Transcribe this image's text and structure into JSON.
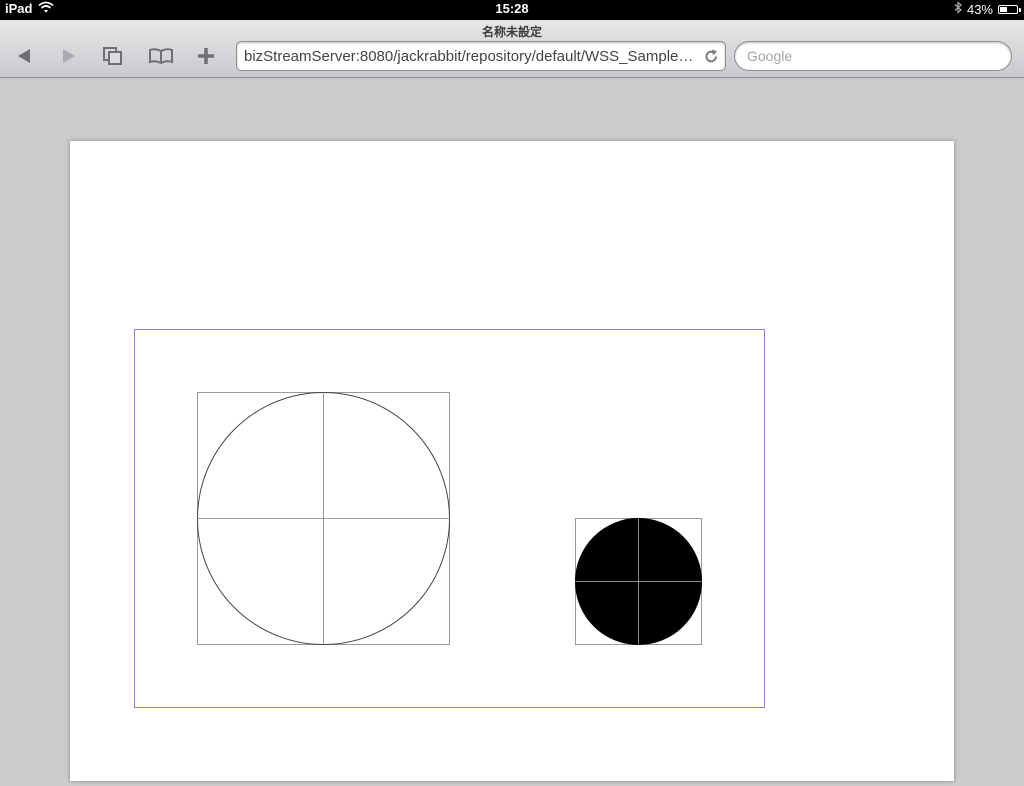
{
  "status_bar": {
    "carrier": "iPad",
    "time": "15:28",
    "battery": "43%",
    "battery_level": 0.43
  },
  "browser": {
    "page_title": "名称未設定",
    "url": "bizStreamServer:8080/jackrabbit/repository/default/WSS_Sample1...",
    "search_placeholder": "Google",
    "icons": {
      "back": "back-arrow-icon",
      "forward": "forward-arrow-icon",
      "pages": "pages-icon",
      "bookmarks": "bookmarks-icon",
      "add": "plus-icon",
      "reload": "reload-icon"
    }
  },
  "document": {
    "frame_color": "#8a80d8",
    "shapes": [
      {
        "kind": "circle",
        "fill": "none",
        "stroke": "#444444"
      },
      {
        "kind": "circle",
        "fill": "#000000",
        "stroke": "#000000"
      }
    ]
  }
}
